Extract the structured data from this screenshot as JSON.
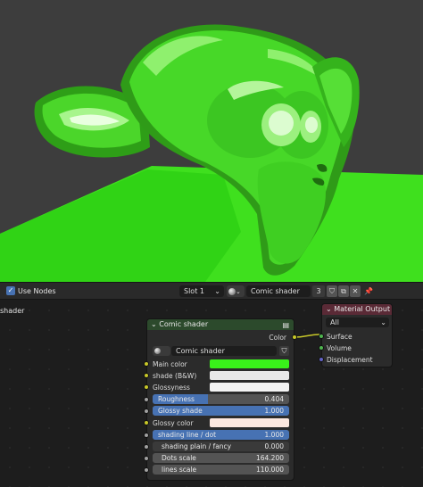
{
  "header": {
    "use_nodes_label": "Use Nodes",
    "slot_label": "Slot 1",
    "material_name": "Comic shader",
    "user_count": "3"
  },
  "editor": {
    "left_label": "shader"
  },
  "comic_node": {
    "title": "Comic shader",
    "output_color": "Color",
    "group_name": "Comic shader",
    "inputs": {
      "main_color": "Main color",
      "shade_bw": "shade (B&W)",
      "glossyness": "Glossyness",
      "glossy_color": "Glossy color"
    },
    "sliders": {
      "roughness_label": "Roughness",
      "roughness_value": "0.404",
      "roughness_fraction": 0.404,
      "glossy_shade_label": "Glossy shade",
      "glossy_shade_value": "1.000",
      "glossy_shade_fraction": 1.0,
      "shading_line_label": "shading line / dot",
      "shading_line_value": "1.000",
      "shading_line_fraction": 1.0,
      "shading_plain_label": "shading plain / fancy",
      "shading_plain_value": "0.000",
      "dots_scale_label": "Dots scale",
      "dots_scale_value": "164.200",
      "lines_scale_label": "lines scale",
      "lines_scale_value": "110.000"
    }
  },
  "output_node": {
    "title": "Material Output",
    "target": "All",
    "surface": "Surface",
    "volume": "Volume",
    "displacement": "Displacement"
  },
  "colors": {
    "main_color": "#39f21a",
    "shade_bw": "#e8e8e8",
    "glossyness": "#f4f4f4",
    "glossy_color": "#fce8e0",
    "socket_yellow": "#c7c729",
    "socket_gray": "#a1a1a1",
    "socket_purple": "#6363c7",
    "accent_blue": "#4772b3",
    "shader_header": "#2c4a2c",
    "output_header": "#5a2a36"
  }
}
